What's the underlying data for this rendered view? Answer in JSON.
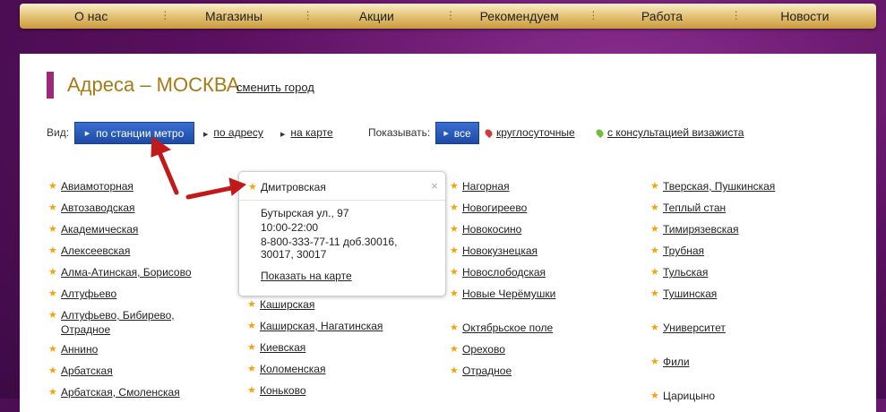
{
  "nav": {
    "items": [
      "О нас",
      "Магазины",
      "Акции",
      "Рекомендуем",
      "Работа",
      "Новости"
    ]
  },
  "page": {
    "title": "Адреса – МОСКВА",
    "change_city": "сменить город"
  },
  "view": {
    "label": "Вид:",
    "active": "по станции метро",
    "by_address": "по адресу",
    "on_map": "на карте"
  },
  "filter": {
    "label": "Показывать:",
    "all": "все",
    "round_clock": "круглосуточные",
    "with_consult": "с консультацией визажиста"
  },
  "colors": {
    "accent_blue": "#1c4aa6",
    "star": "#f2a50c",
    "title": "#a77a18",
    "pin_red": "#d23a3a",
    "pin_green": "#6fbe3a",
    "arrow": "#c01a1a"
  },
  "columns": {
    "col1": [
      "Авиамоторная",
      "Автозаводская",
      "Академическая",
      "Алексеевская",
      "Алма-Атинская, Борисово",
      "Алтуфьево",
      "Алтуфьево, Бибирево, Отрадное",
      "Аннино",
      "Арбатская",
      "Арбатская, Смоленская"
    ],
    "col2": [
      "Каширская",
      "Каширская, Нагатинская",
      "Киевская",
      "Коломенская",
      "Коньково"
    ],
    "col3": [
      "Нагорная",
      "Новогиреево",
      "Новокосино",
      "Новокузнецкая",
      "Новослободская",
      "Новые Черёмушки",
      "Октябрьское поле",
      "Орехово",
      "Отрадное"
    ],
    "col4": [
      "Тверская, Пушкинская",
      "Теплый стан",
      "Тимирязевская",
      "Трубная",
      "Тульская",
      "Тушинская",
      "Университет",
      "Фили",
      "Царицыно"
    ]
  },
  "popup": {
    "station": "Дмитровская",
    "close_icon": "×",
    "address": "Бутырская ул., 97",
    "hours": "10:00-22:00",
    "phone": "8-800-333-77-11 доб.30016,",
    "phone2": "30017, 30017",
    "show_on_map": "Показать на карте"
  }
}
